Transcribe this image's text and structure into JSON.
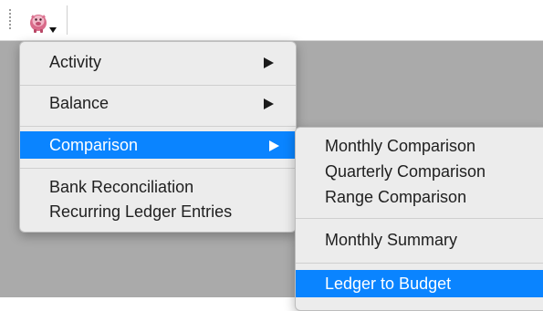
{
  "toolbar": {
    "app_icon": "piggy-bank-icon",
    "dropdown_indicator": "triangle-down-icon"
  },
  "colors": {
    "highlight": "#0a84ff",
    "menu_bg": "#ececec",
    "workarea_bg": "#aaaaaa"
  },
  "menu": {
    "items": [
      {
        "label": "Activity",
        "submenu": true
      },
      {
        "label": "Balance",
        "submenu": true
      },
      {
        "label": "Comparison",
        "submenu": true,
        "highlighted": true
      },
      {
        "label": "Bank Reconciliation",
        "submenu": false
      },
      {
        "label": "Recurring Ledger Entries",
        "submenu": false
      }
    ]
  },
  "submenu": {
    "items": [
      {
        "label": "Monthly Comparison"
      },
      {
        "label": "Quarterly Comparison"
      },
      {
        "label": "Range Comparison"
      },
      {
        "label": "Monthly Summary"
      },
      {
        "label": "Ledger to Budget",
        "highlighted": true
      }
    ]
  }
}
